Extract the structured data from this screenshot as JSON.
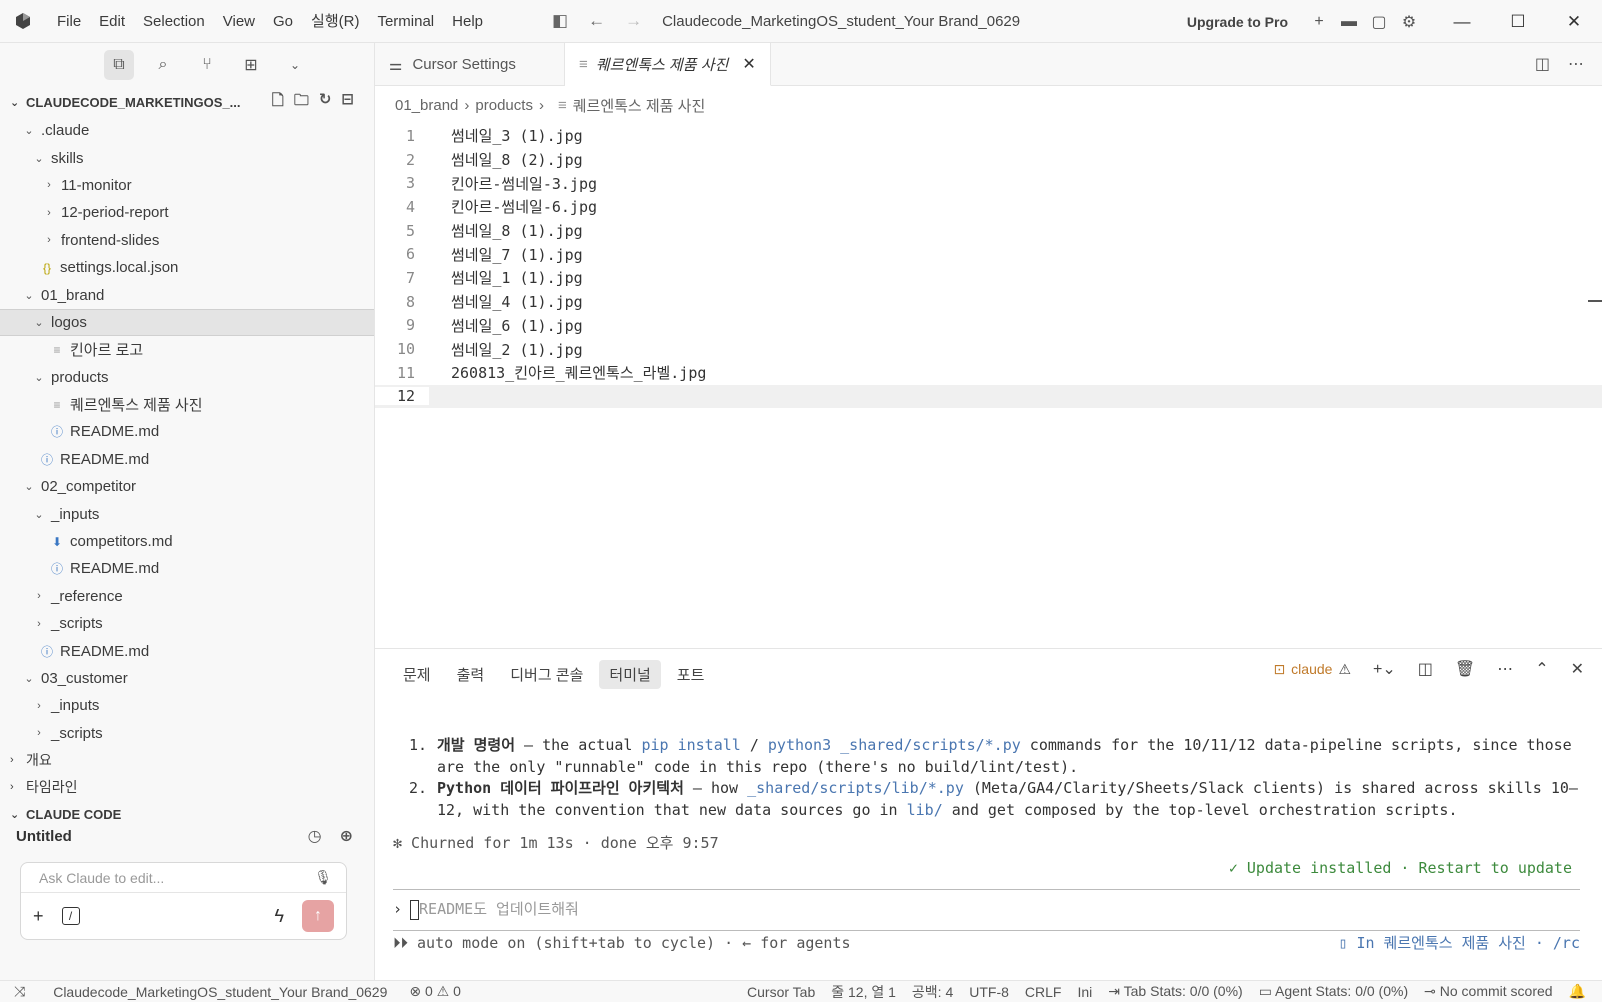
{
  "titlebar": {
    "menu": [
      "File",
      "Edit",
      "Selection",
      "View",
      "Go",
      "실행(R)",
      "Terminal",
      "Help"
    ],
    "title": "Claudecode_MarketingOS_student_Your Brand_0629",
    "upgrade": "Upgrade to Pro"
  },
  "explorer": {
    "root": "CLAUDECODE_MARKETINGOS_...",
    "tree": [
      {
        "label": ".claude",
        "indent": 0,
        "type": "folder-open"
      },
      {
        "label": "skills",
        "indent": 1,
        "type": "folder-open"
      },
      {
        "label": "11-monitor",
        "indent": 2,
        "type": "folder"
      },
      {
        "label": "12-period-report",
        "indent": 2,
        "type": "folder"
      },
      {
        "label": "frontend-slides",
        "indent": 2,
        "type": "folder"
      },
      {
        "label": "settings.local.json",
        "indent": 1,
        "type": "json"
      },
      {
        "label": "01_brand",
        "indent": 0,
        "type": "folder-open"
      },
      {
        "label": "logos",
        "indent": 1,
        "type": "folder-open",
        "selected": true
      },
      {
        "label": "킨아르 로고",
        "indent": 2,
        "type": "txt"
      },
      {
        "label": "products",
        "indent": 1,
        "type": "folder-open"
      },
      {
        "label": "퀘르엔톡스 제품 사진",
        "indent": 2,
        "type": "txt"
      },
      {
        "label": "README.md",
        "indent": 2,
        "type": "info"
      },
      {
        "label": "README.md",
        "indent": 1,
        "type": "info"
      },
      {
        "label": "02_competitor",
        "indent": 0,
        "type": "folder-open"
      },
      {
        "label": "_inputs",
        "indent": 1,
        "type": "folder-open"
      },
      {
        "label": "competitors.md",
        "indent": 2,
        "type": "md"
      },
      {
        "label": "README.md",
        "indent": 2,
        "type": "info"
      },
      {
        "label": "_reference",
        "indent": 1,
        "type": "folder"
      },
      {
        "label": "_scripts",
        "indent": 1,
        "type": "folder"
      },
      {
        "label": "README.md",
        "indent": 1,
        "type": "info"
      },
      {
        "label": "03_customer",
        "indent": 0,
        "type": "folder-open"
      },
      {
        "label": "_inputs",
        "indent": 1,
        "type": "folder"
      },
      {
        "label": "_scripts",
        "indent": 1,
        "type": "folder"
      }
    ],
    "outline": "개요",
    "timeline": "타임라인",
    "claude_code": "CLAUDE CODE"
  },
  "claude_panel": {
    "title": "Untitled",
    "placeholder": "Ask Claude to edit..."
  },
  "tabs": [
    {
      "label": "Cursor Settings",
      "active": false
    },
    {
      "label": "퀘르엔톡스 제품 사진",
      "active": true
    }
  ],
  "breadcrumb": [
    "01_brand",
    "products",
    "퀘르엔톡스 제품 사진"
  ],
  "code_lines": [
    "썸네일_3 (1).jpg",
    "썸네일_8 (2).jpg",
    "킨아르-썸네일-3.jpg",
    "킨아르-썸네일-6.jpg",
    "썸네일_8 (1).jpg",
    "썸네일_7 (1).jpg",
    "썸네일_1 (1).jpg",
    "썸네일_4 (1).jpg",
    "썸네일_6 (1).jpg",
    "썸네일_2 (1).jpg",
    "260813_킨아르_퀘르엔톡스_라벨.jpg",
    ""
  ],
  "panel": {
    "tabs": [
      "문제",
      "출력",
      "디버그 콘솔",
      "터미널",
      "포트"
    ],
    "active_tab": "터미널",
    "terminal_name": "claude",
    "item1_num": "1.",
    "item1_bold": "개발 명령어",
    "item1_a": " — the actual ",
    "item1_code1": "pip install",
    "item1_b": " / ",
    "item1_code2": "python3 _shared/scripts/*.py",
    "item1_c": " commands for the 10/11/12 data-pipeline scripts, since those are the only \"runnable\" code in this repo (there's no build/lint/test).",
    "item2_num": "2.",
    "item2_bold": "Python 데이터 파이프라인 아키텍처",
    "item2_a": " — how ",
    "item2_code1": "_shared/scripts/lib/*.py",
    "item2_b": " (Meta/GA4/Clarity/Sheets/Slack clients) is shared across skills 10–12, with the convention that new data sources go in ",
    "item2_code2": "lib/",
    "item2_c": " and get composed by the top-level orchestration scripts.",
    "churn": "✻ Churned for 1m 13s · done 오후 9:57",
    "update": "✓ Update installed · Restart to update",
    "prompt": "README도 업데이트해줘",
    "auto_mode": "⏵⏵ auto mode on (shift+tab to cycle) · ← for agents",
    "in_file": "▯ In 퀘르엔톡스 제품 사진 · /rc"
  },
  "status": {
    "repo": "Claudecode_MarketingOS_student_Your Brand_0629",
    "errors": "⊗ 0 ⚠ 0",
    "cursor_tab": "Cursor Tab",
    "position": "줄 12, 열 1",
    "spaces": "공백: 4",
    "encoding": "UTF-8",
    "eol": "CRLF",
    "lang": "Ini",
    "tab_stats": "⇥ Tab Stats: 0/0 (0%)",
    "agent_stats": "▭ Agent Stats: 0/0 (0%)",
    "commit": "⊸ No commit scored"
  }
}
